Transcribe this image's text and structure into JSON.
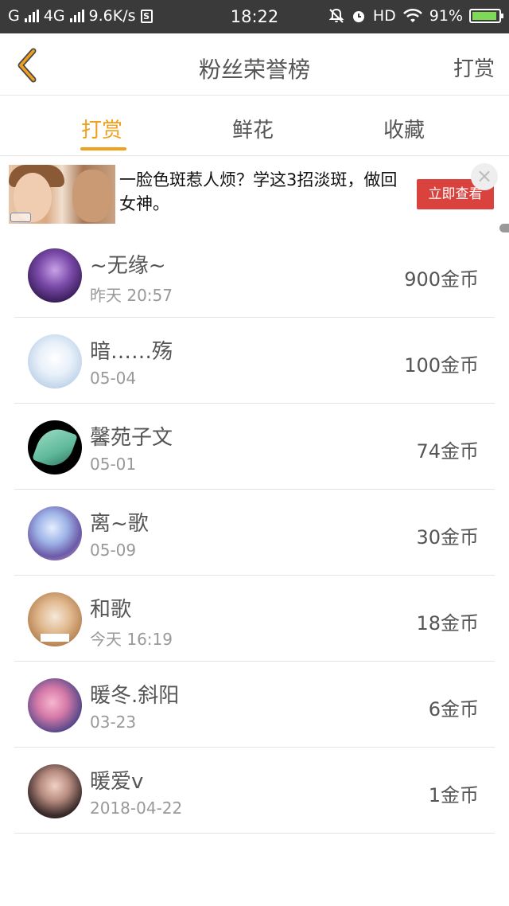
{
  "status_bar": {
    "carrier": "G",
    "network": "4G",
    "speed": "9.6K/s",
    "s_badge": "S",
    "time": "18:22",
    "hd": "HD",
    "battery": "91%",
    "icons": [
      "signal-icon",
      "mute-bell-icon",
      "alarm-icon",
      "wifi-icon",
      "battery-icon"
    ]
  },
  "header": {
    "title": "粉丝荣誉榜",
    "action": "打赏",
    "back_icon": "chevron-left-icon",
    "back_color": "#f0a01c"
  },
  "tabs": [
    {
      "label": "打赏",
      "active": true
    },
    {
      "label": "鲜花",
      "active": false
    },
    {
      "label": "收藏",
      "active": false
    }
  ],
  "accent_color": "#f0a01c",
  "ad": {
    "text": "一脸色斑惹人烦？学这3招淡斑，做回女神。",
    "button": "立即查看",
    "close": "×"
  },
  "fans": [
    {
      "name": "~无缘~",
      "date": "昨天 20:57",
      "amount": "900金币"
    },
    {
      "name": "暗……殇",
      "date": "05-04",
      "amount": "100金币"
    },
    {
      "name": "馨苑子文",
      "date": "05-01",
      "amount": "74金币"
    },
    {
      "name": "离~歌",
      "date": "05-09",
      "amount": "30金币"
    },
    {
      "name": "和歌",
      "date": "今天 16:19",
      "amount": "18金币"
    },
    {
      "name": "暖冬.斜阳",
      "date": "03-23",
      "amount": "6金币"
    },
    {
      "name": "暖爱v",
      "date": "2018-04-22",
      "amount": "1金币"
    }
  ]
}
